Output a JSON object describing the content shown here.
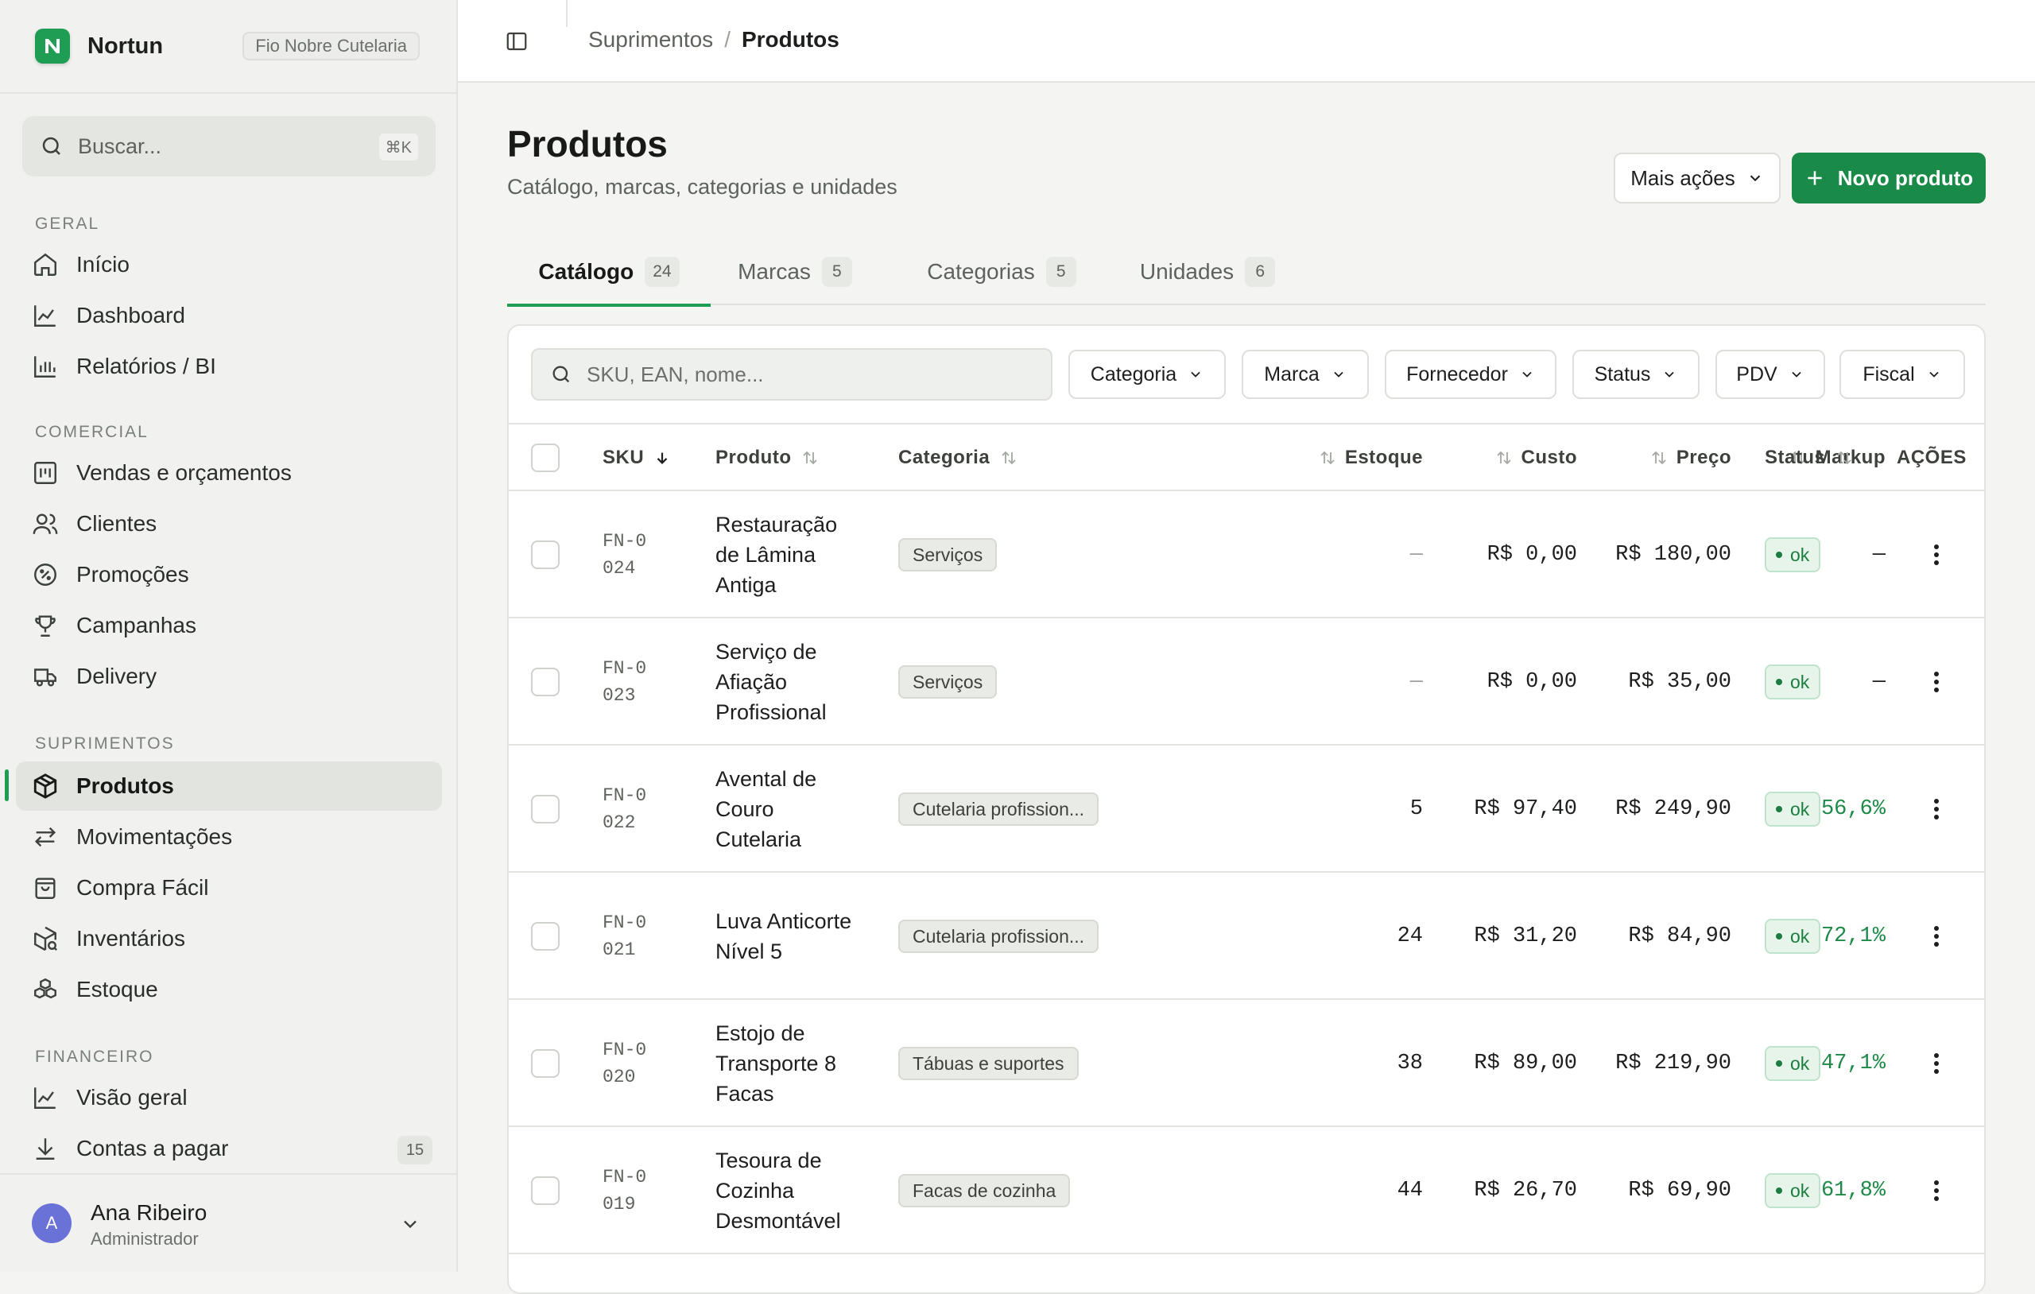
{
  "brand": {
    "name": "Nortun",
    "org": "Fio Nobre Cutelaria"
  },
  "search": {
    "placeholder": "Buscar...",
    "shortcut": "⌘K"
  },
  "sidebar": {
    "sections": [
      {
        "title": "GERAL",
        "items": [
          {
            "label": "Início",
            "icon": "home-icon"
          },
          {
            "label": "Dashboard",
            "icon": "line-chart-icon"
          },
          {
            "label": "Relatórios / BI",
            "icon": "bar-chart-icon"
          }
        ]
      },
      {
        "title": "COMERCIAL",
        "items": [
          {
            "label": "Vendas e orçamentos",
            "icon": "register-icon"
          },
          {
            "label": "Clientes",
            "icon": "users-icon"
          },
          {
            "label": "Promoções",
            "icon": "percent-badge-icon"
          },
          {
            "label": "Campanhas",
            "icon": "trophy-icon"
          },
          {
            "label": "Delivery",
            "icon": "truck-icon"
          }
        ]
      },
      {
        "title": "SUPRIMENTOS",
        "items": [
          {
            "label": "Produtos",
            "icon": "box-icon",
            "active": true
          },
          {
            "label": "Movimentações",
            "icon": "arrows-swap-icon"
          },
          {
            "label": "Compra Fácil",
            "icon": "shopping-bag-icon"
          },
          {
            "label": "Inventários",
            "icon": "box-search-icon"
          },
          {
            "label": "Estoque",
            "icon": "boxes-icon"
          }
        ]
      },
      {
        "title": "FINANCEIRO",
        "items": [
          {
            "label": "Visão geral",
            "icon": "line-chart-icon"
          },
          {
            "label": "Contas a pagar",
            "icon": "download-icon",
            "count": "15"
          }
        ]
      }
    ]
  },
  "user": {
    "initial": "A",
    "name": "Ana Ribeiro",
    "role": "Administrador"
  },
  "breadcrumb": {
    "parent": "Suprimentos",
    "separator": "/",
    "current": "Produtos"
  },
  "page": {
    "title": "Produtos",
    "subtitle": "Catálogo, marcas, categorias e unidades",
    "more_actions": "Mais ações",
    "new_product": "Novo produto"
  },
  "tabs": [
    {
      "label": "Catálogo",
      "count": "24",
      "active": true
    },
    {
      "label": "Marcas",
      "count": "5"
    },
    {
      "label": "Categorias",
      "count": "5"
    },
    {
      "label": "Unidades",
      "count": "6"
    }
  ],
  "table": {
    "search_placeholder": "SKU, EAN, nome...",
    "filters": [
      "Categoria",
      "Marca",
      "Fornecedor",
      "Status",
      "PDV",
      "Fiscal"
    ],
    "columns": {
      "sku": "SKU",
      "produto": "Produto",
      "categoria": "Categoria",
      "estoque": "Estoque",
      "custo": "Custo",
      "preco": "Preço",
      "markup": "Markup",
      "status": "Status",
      "acoes": "AÇÕES"
    },
    "rows": [
      {
        "sku": "FN-0024",
        "produto": "Restauração de Lâmina Antiga",
        "categoria": "Serviços",
        "estoque": "—",
        "custo": "R$ 0,00",
        "preco": "R$ 180,00",
        "markup": "—",
        "status": "ok"
      },
      {
        "sku": "FN-0023",
        "produto": "Serviço de Afiação Profissional",
        "categoria": "Serviços",
        "estoque": "—",
        "custo": "R$ 0,00",
        "preco": "R$ 35,00",
        "markup": "—",
        "status": "ok"
      },
      {
        "sku": "FN-0022",
        "produto": "Avental de Couro Cutelaria",
        "categoria": "Cutelaria profission...",
        "estoque": "5",
        "custo": "R$ 97,40",
        "preco": "R$ 249,90",
        "markup": "156,6%",
        "status": "ok"
      },
      {
        "sku": "FN-0021",
        "produto": "Luva Anticorte Nível 5",
        "categoria": "Cutelaria profission...",
        "estoque": "24",
        "custo": "R$ 31,20",
        "preco": "R$ 84,90",
        "markup": "172,1%",
        "status": "ok"
      },
      {
        "sku": "FN-0020",
        "produto": "Estojo de Transporte 8 Facas",
        "categoria": "Tábuas e suportes",
        "estoque": "38",
        "custo": "R$ 89,00",
        "preco": "R$ 219,90",
        "markup": "147,1%",
        "status": "ok"
      },
      {
        "sku": "FN-0019",
        "produto": "Tesoura de Cozinha Desmontável",
        "categoria": "Facas de cozinha",
        "estoque": "44",
        "custo": "R$ 26,70",
        "preco": "R$ 69,90",
        "markup": "161,8%",
        "status": "ok"
      }
    ]
  },
  "colors": {
    "accent": "#1f9d55",
    "primary_button": "#198a48",
    "markup_text": "#1d8a47",
    "status_ok_bg": "#e6f4ea"
  }
}
